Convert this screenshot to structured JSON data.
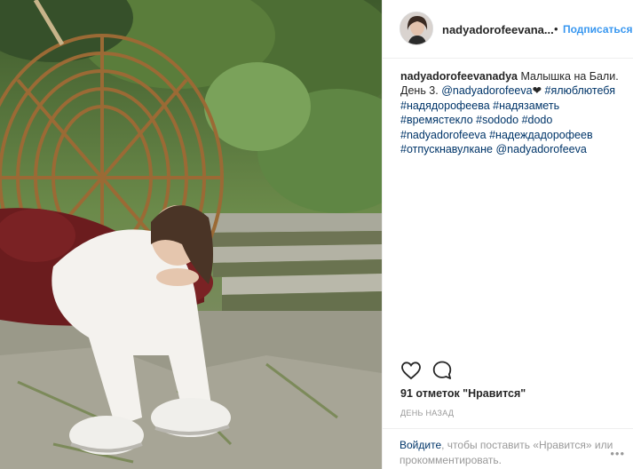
{
  "post": {
    "username": "nadyadorofeevana...",
    "dot": "•",
    "follow_label": "Подписаться",
    "caption_user": "nadyadorofeevanadya",
    "caption_text1": " Малышка на Бали. День 3. ",
    "mention1": "@nadyadorofeeva",
    "heart": "❤",
    "tags": [
      "#ялюблютебя",
      "#надядорофеева",
      "#надязаметь",
      "#времястекло",
      "#sododo",
      "#dodo",
      "#nadyadorofeeva",
      "#надеждадорофеев",
      "#отпускнавулкане"
    ],
    "mention2": "@nadyadorofeeva",
    "likes": "91 отметок \"Нравится\"",
    "time": "ДЕНЬ НАЗАД",
    "login_link": "Войдите",
    "login_text": ", чтобы поставить «Нравится» или прокомментировать.",
    "more": "•••"
  },
  "icons": {
    "like": "heart-icon",
    "comment": "comment-icon"
  }
}
